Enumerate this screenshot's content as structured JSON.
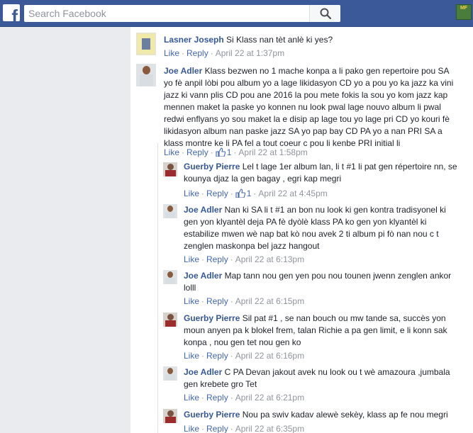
{
  "search": {
    "placeholder": "Search Facebook"
  },
  "app_badge": "MF",
  "comments": [
    {
      "author": "Lasner Joseph",
      "text": "Si Klass nan tèt anlè ki yes?",
      "like": "Like",
      "reply": "Reply",
      "time": "April 22 at 1:37pm"
    },
    {
      "author": "Joe Adler",
      "text": "Klass bezwen no 1 mache konpa a li pako gen repertoire pou SA yo fè anpil lòbi pou album yo a lage likidasyon CD yo a pou yo ka jazz ka vini jazz ki vann plis CD pou ane 2016 la pou mete fokis la sou yo kom jazz kap mennen maket la paske yo konnen nu look pwal lage nouvo album li pwal redwi enflyans yo sou maket la e disip ap lage tou yo lage pri CD yo kouri fè likidasyon album nan paske jazz SA yo pap bay CD PA yo a nan PRI SA a klass montre ke li PA fel a tout coeur c pou li kenbe PRI initial li",
      "like": "Like",
      "reply": "Reply",
      "likes": "1",
      "time": "April 22 at 1:58pm"
    }
  ],
  "replies": [
    {
      "author": "Guerby Pierre",
      "text": "Lel t lage 1er album lan, li t #1 li pat gen répertoire nn, se kounya djaz la gen bagay , egri kap megri",
      "like": "Like",
      "reply": "Reply",
      "likes": "1",
      "time": "April 22 at 4:45pm"
    },
    {
      "author": "Joe Adler",
      "text": "Nan ki SA li t #1 an bon nu look ki gen kontra tradisyonel ki gen yon klyantèl deja PA fè dyòlè klass PA ko gen yon klyantèl ki estabilize mwen wè nap bat kò nou avek 2 ti album pi fò nan nou c t zenglen maskonpa bel jazz hangout",
      "like": "Like",
      "reply": "Reply",
      "time": "April 22 at 6:13pm"
    },
    {
      "author": "Joe Adler",
      "text": "Map tann nou gen yen pou nou tounen jwenn zenglen ankor lolll",
      "like": "Like",
      "reply": "Reply",
      "time": "April 22 at 6:15pm"
    },
    {
      "author": "Guerby Pierre",
      "text": "Sil pat #1 , se nan bouch ou mw tande sa, succès yon moun anyen pa k blokel frem, talan Richie a pa gen limit, e li konn sak konpa , nou gen tet nou gen ko",
      "like": "Like",
      "reply": "Reply",
      "time": "April 22 at 6:16pm"
    },
    {
      "author": "Joe Adler",
      "text": "C PA Devan jakout avek nu look ou t wè amazoura ,jumbala gen krebete gro Tet",
      "like": "Like",
      "reply": "Reply",
      "time": "April 22 at 6:21pm"
    },
    {
      "author": "Guerby Pierre",
      "text": "Nou pa swiv kadav alewè sekèy, klass ap fe nou megri",
      "like": "Like",
      "reply": "Reply",
      "time": "April 22 at 6:35pm"
    }
  ]
}
